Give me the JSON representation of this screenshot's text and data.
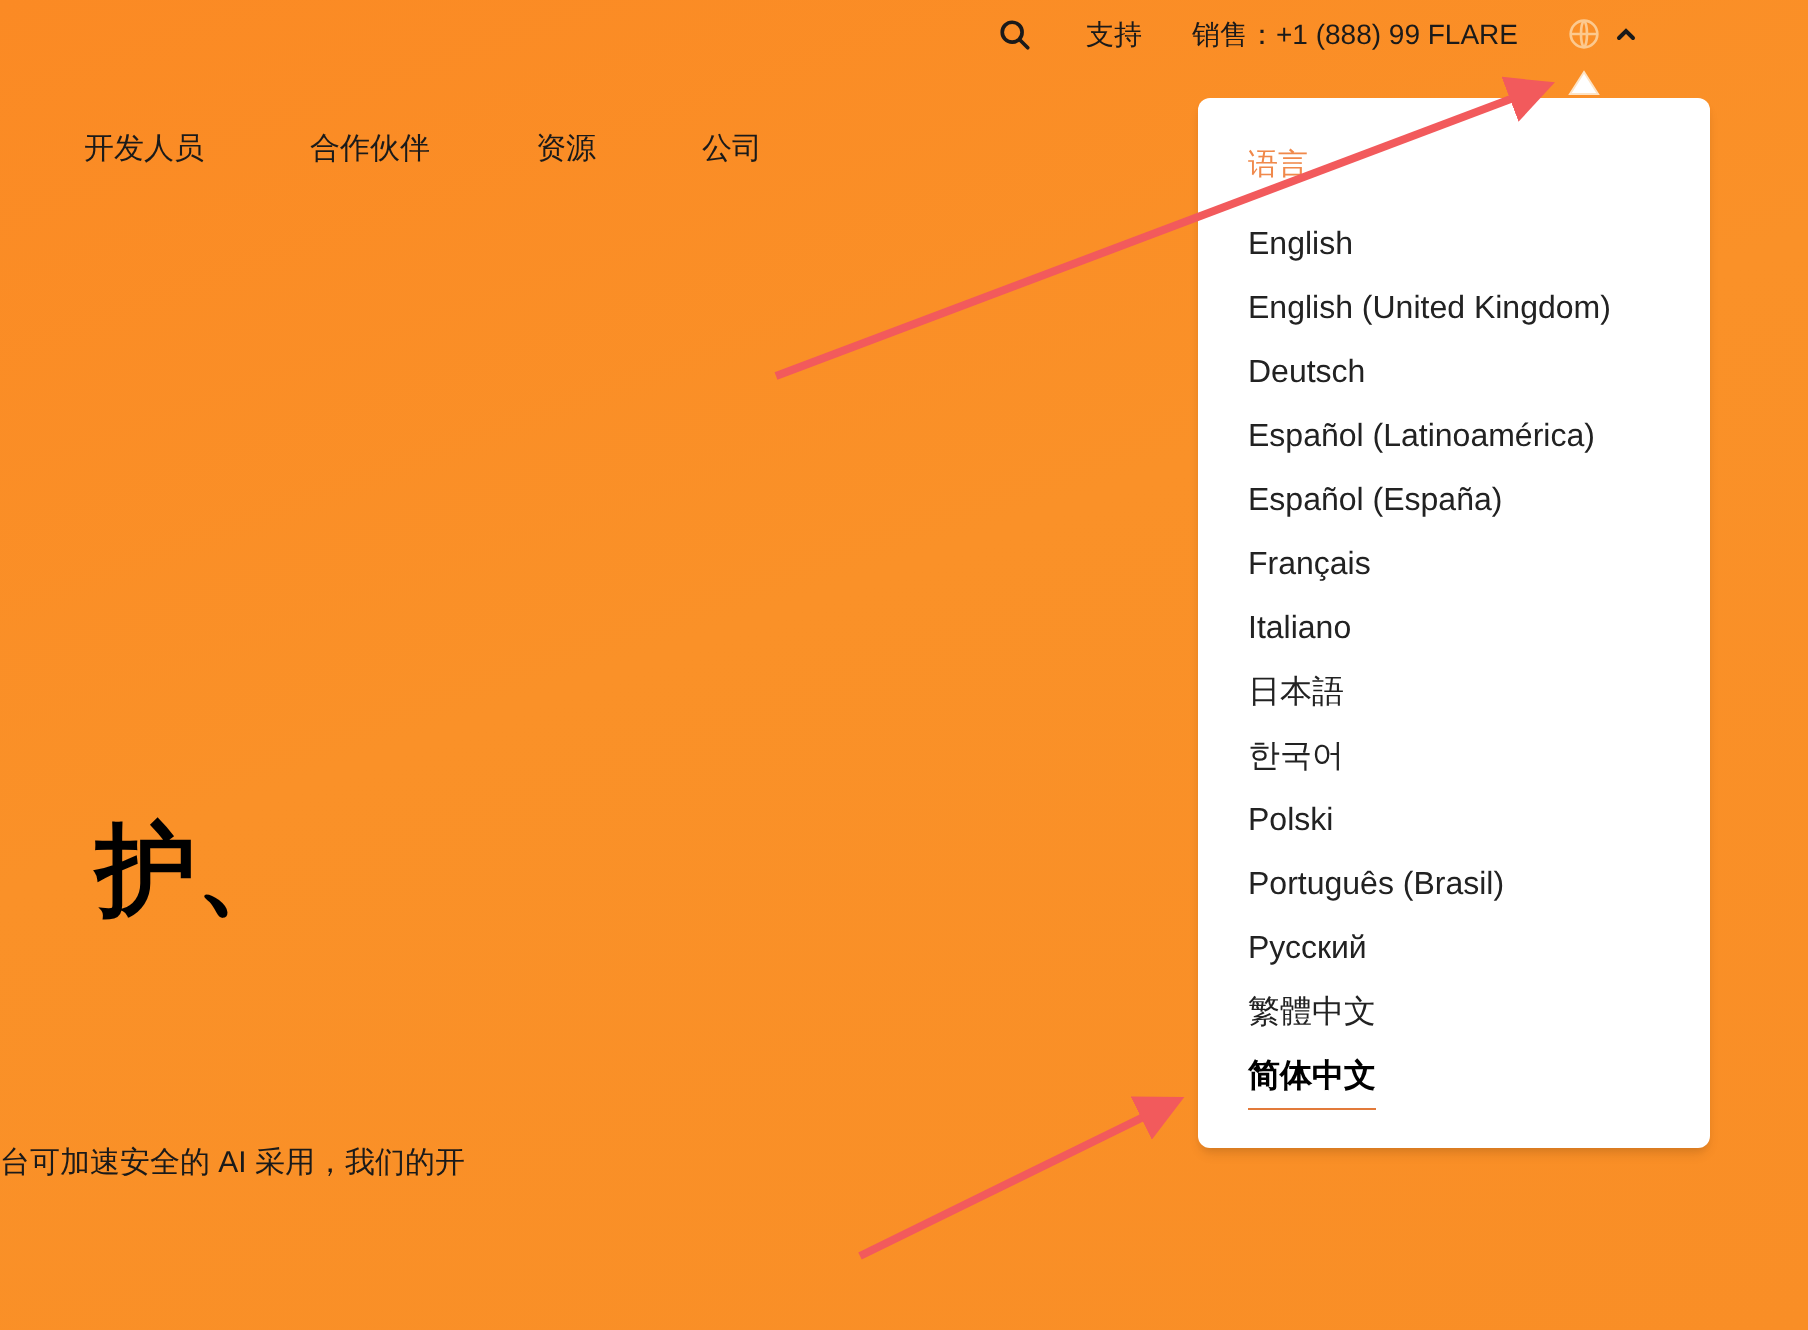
{
  "top_bar": {
    "links": [
      {
        "label": "支持"
      },
      {
        "label": "销售：+1 (888) 99 FLARE"
      }
    ],
    "language_menu_open": true
  },
  "nav": {
    "items": [
      {
        "label": "开发人员"
      },
      {
        "label": "合作伙伴"
      },
      {
        "label": "资源"
      },
      {
        "label": "公司"
      }
    ]
  },
  "hero": {
    "heading": "护、",
    "paragraph": "台可加速安全的 AI 采用，我们的开"
  },
  "language_menu": {
    "title": "语言",
    "items": [
      {
        "label": "English",
        "selected": false
      },
      {
        "label": "English (United Kingdom)",
        "selected": false
      },
      {
        "label": "Deutsch",
        "selected": false
      },
      {
        "label": "Español (Latinoamérica)",
        "selected": false
      },
      {
        "label": "Español (España)",
        "selected": false
      },
      {
        "label": "Français",
        "selected": false
      },
      {
        "label": "Italiano",
        "selected": false
      },
      {
        "label": "日本語",
        "selected": false
      },
      {
        "label": "한국어",
        "selected": false
      },
      {
        "label": "Polski",
        "selected": false
      },
      {
        "label": "Português (Brasil)",
        "selected": false
      },
      {
        "label": "Русский",
        "selected": false
      },
      {
        "label": "繁體中文",
        "selected": false
      },
      {
        "label": "简体中文",
        "selected": true
      }
    ]
  }
}
